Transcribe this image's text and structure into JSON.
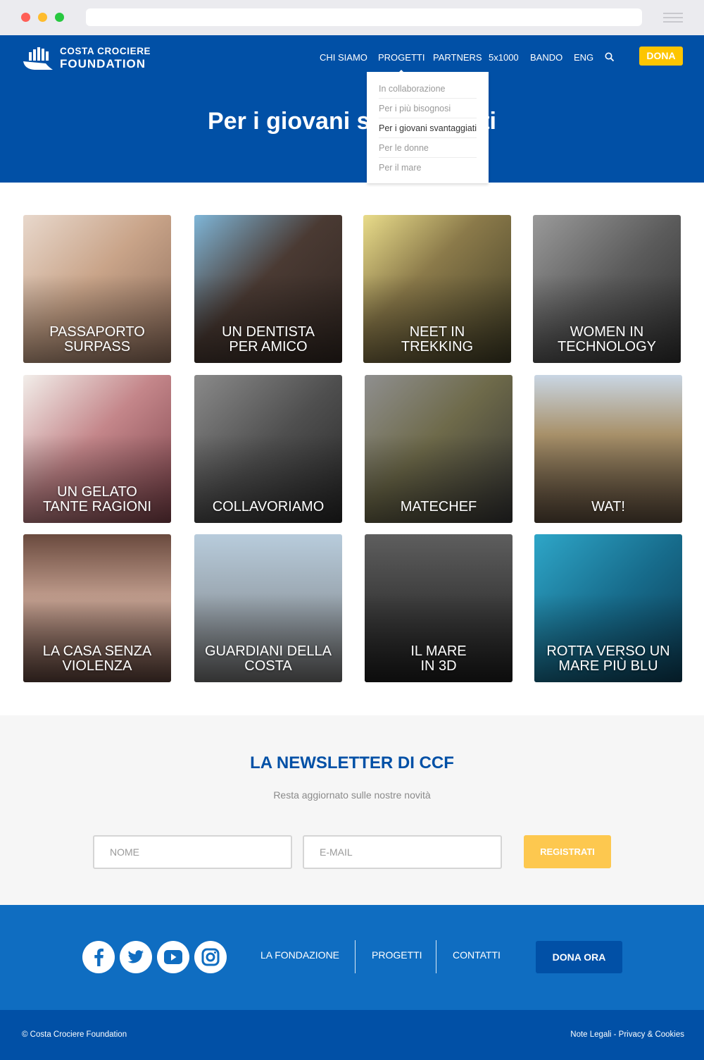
{
  "nav": {
    "items": [
      "CHI SIAMO",
      "PROGETTI",
      "PARTNERS",
      "5x1000",
      "BANDO",
      "ENG"
    ],
    "donate_label": "DONA"
  },
  "logo": {
    "line1": "COSTA CROCIERE",
    "line2": "FOUNDATION"
  },
  "dropdown": {
    "items": [
      "In collaborazione",
      "Per i più bisognosi",
      "Per i giovani svantaggiati",
      "Per le donne",
      "Per il mare"
    ],
    "selected": "Per i giovani svantaggiati"
  },
  "hero": {
    "title": "Per i giovani svantaggiati"
  },
  "projects": [
    {
      "line1": "PASSAPORTO",
      "line2": "SURPASS"
    },
    {
      "line1": "UN DENTISTA",
      "line2": "PER AMICO"
    },
    {
      "line1": "NEET IN",
      "line2": "TREKKING"
    },
    {
      "line1": "WOMEN IN",
      "line2": "TECHNOLOGY"
    },
    {
      "line1": "UN GELATO",
      "line2": "TANTE RAGIONI"
    },
    {
      "line1": "",
      "line2": "COLLAVORIAMO"
    },
    {
      "line1": "",
      "line2": "MATECHEF"
    },
    {
      "line1": "",
      "line2": "WAT!"
    },
    {
      "line1": "LA CASA SENZA",
      "line2": "VIOLENZA"
    },
    {
      "line1": "GUARDIANI DELLA",
      "line2": "COSTA"
    },
    {
      "line1": "IL MARE",
      "line2": "IN 3D"
    },
    {
      "line1": "ROTTA VERSO UN",
      "line2": "MARE PIÙ BLU"
    }
  ],
  "newsletter": {
    "title": "LA NEWSLETTER DI CCF",
    "subtitle": "Resta aggiornato sulle nostre novità",
    "name_placeholder": "NOME",
    "email_placeholder": "E-MAIL",
    "submit_label": "REGISTRATI"
  },
  "footer": {
    "social_icons": [
      "facebook-icon",
      "twitter-icon",
      "youtube-icon",
      "instagram-icon"
    ],
    "links": [
      "LA FONDAZIONE",
      "PROGETTI",
      "CONTATTI"
    ],
    "donate_label": "DONA ORA",
    "copyright": "© Costa Crociere Foundation",
    "legal": "Note Legali - Privacy & Cookies"
  },
  "colors": {
    "brand_blue": "#0150a6",
    "footer_blue": "#0f6dc1",
    "accent_yellow": "#fdc500"
  }
}
